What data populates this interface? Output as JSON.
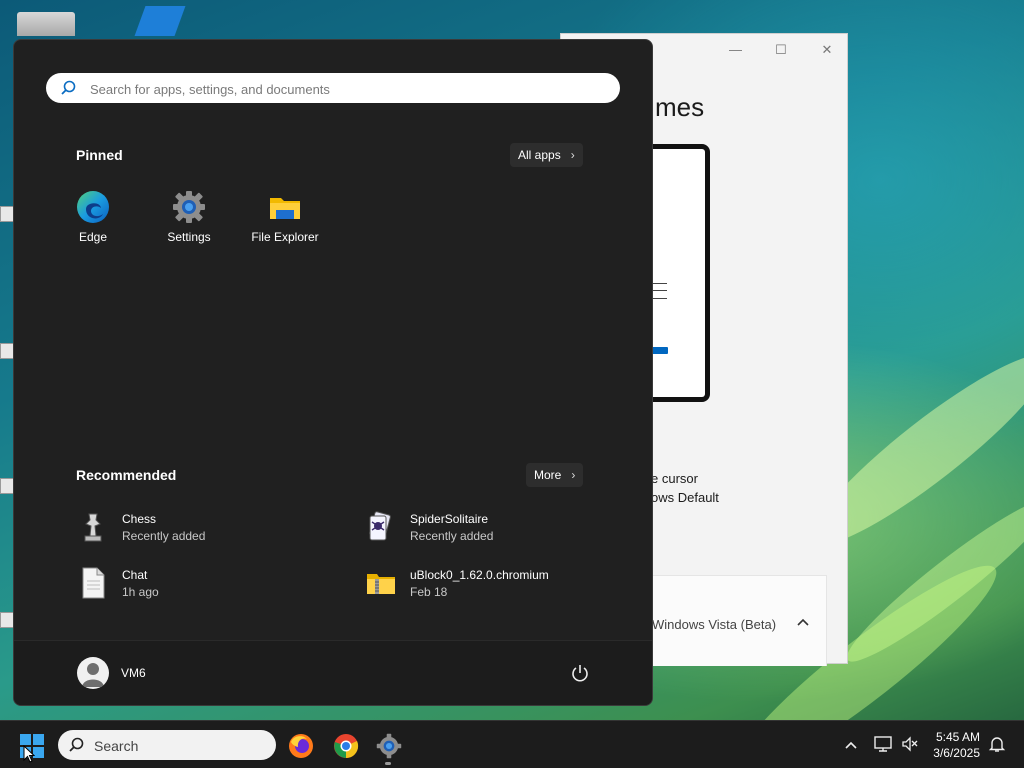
{
  "settings_window": {
    "title_fragment": "mes",
    "text_line1": "e cursor",
    "text_line2": "ows Default",
    "card_text": "Windows Vista (Beta)",
    "controls": [
      "—",
      "☐",
      "✕"
    ]
  },
  "start_menu": {
    "search_placeholder": "Search for apps, settings, and documents",
    "pinned_title": "Pinned",
    "all_apps_label": "All apps",
    "pinned_apps": [
      {
        "label": "Edge",
        "icon": "edge-icon"
      },
      {
        "label": "Settings",
        "icon": "settings-gear-icon"
      },
      {
        "label": "File Explorer",
        "icon": "folder-icon"
      }
    ],
    "recommended_title": "Recommended",
    "more_label": "More",
    "recommended": [
      {
        "name": "Chess",
        "sub": "Recently added",
        "icon": "chess-icon"
      },
      {
        "name": "SpiderSolitaire",
        "sub": "Recently added",
        "icon": "spider-solitaire-icon"
      },
      {
        "name": "Chat",
        "sub": "1h ago",
        "icon": "document-icon"
      },
      {
        "name": "uBlock0_1.62.0.chromium",
        "sub": "Feb 18",
        "icon": "zip-folder-icon"
      }
    ],
    "user_name": "VM6"
  },
  "taskbar": {
    "search_label": "Search",
    "apps": [
      "firefox-icon",
      "chrome-icon",
      "settings-gear-icon"
    ],
    "time": "5:45 AM",
    "date": "3/6/2025"
  },
  "colors": {
    "start_bg": "#202020",
    "taskbar_bg": "#1c1c1c",
    "accent_blue": "#0067c0"
  }
}
